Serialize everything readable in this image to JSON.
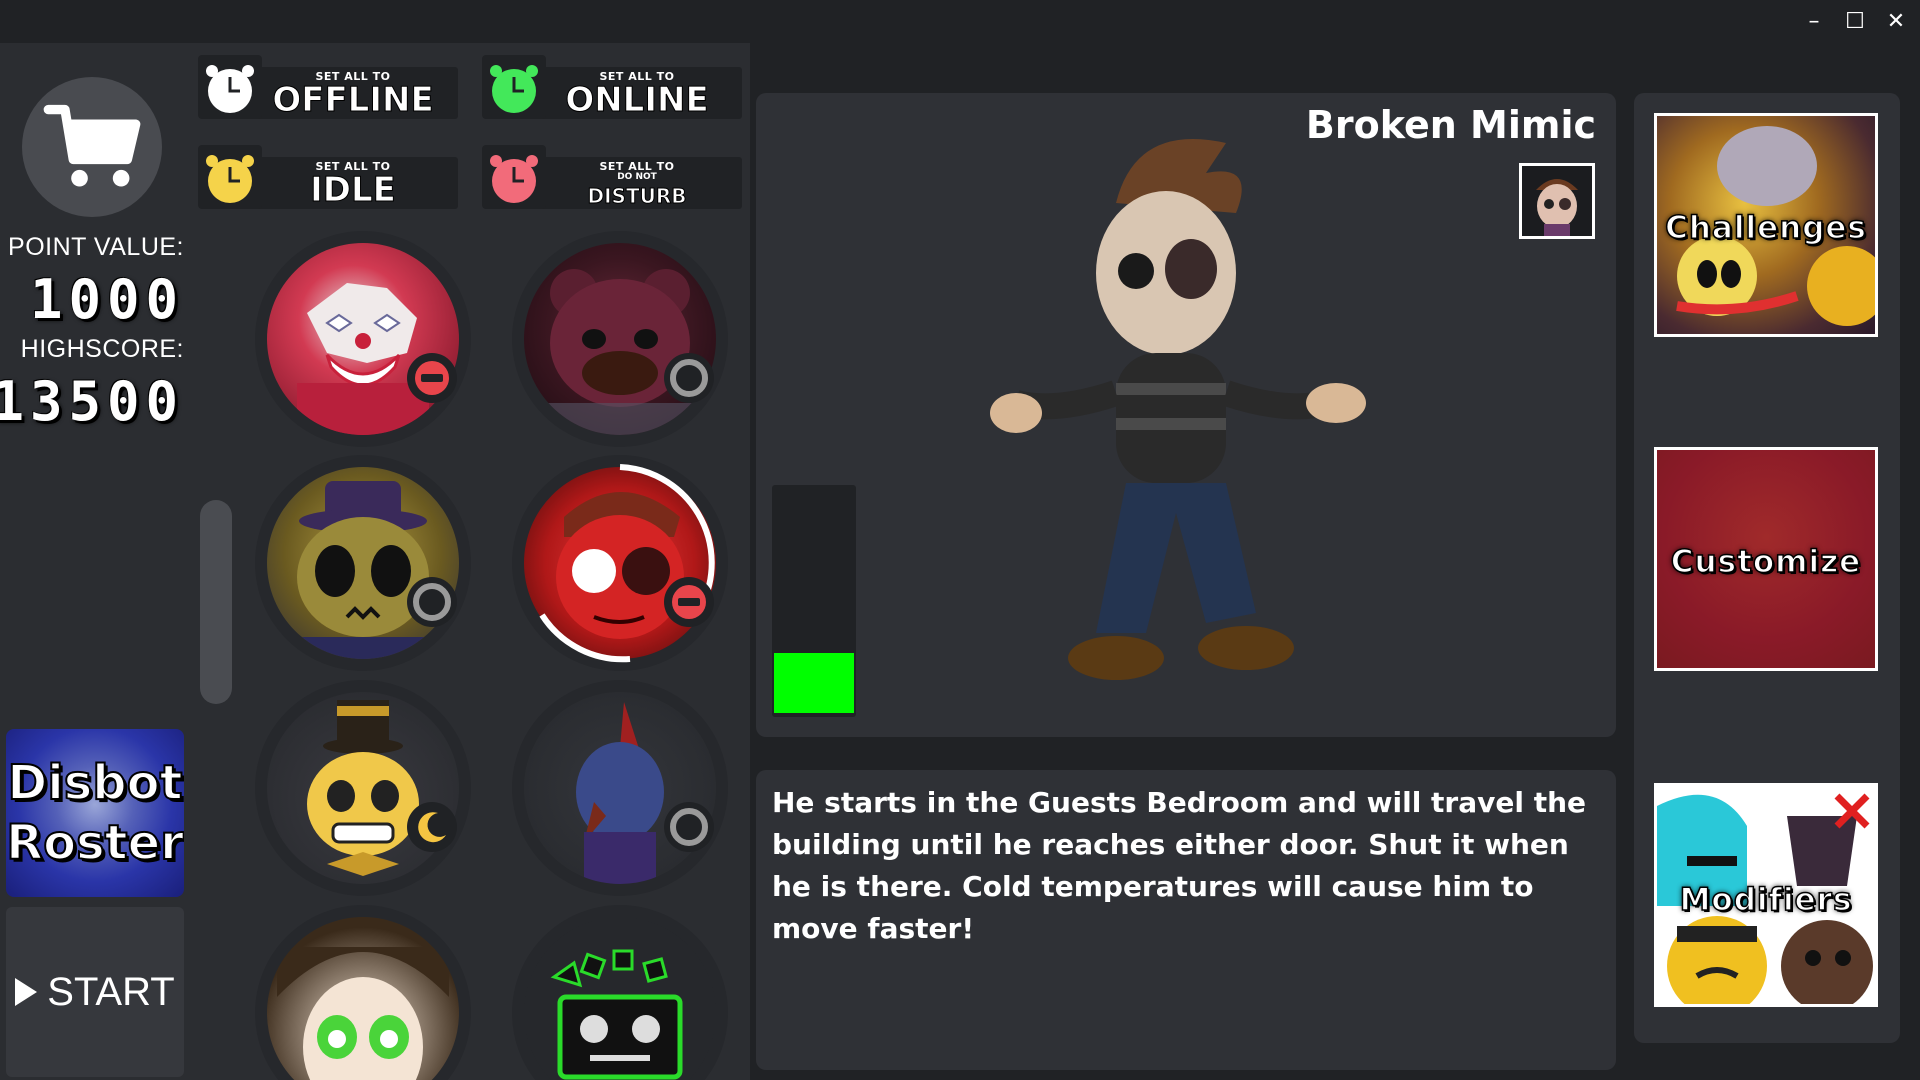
{
  "window": {
    "minimize_icon": "minimize-icon",
    "maximize_icon": "maximize-icon",
    "close_icon": "close-icon",
    "min_glyph": "–",
    "max_glyph": "☐",
    "close_glyph": "✕"
  },
  "sidebar": {
    "shop_icon": "shopping-cart-icon",
    "point_value_label": "POINT VALUE:",
    "point_value": "1000",
    "highscore_label": "HIGHSCORE:",
    "highscore": "13500",
    "roster_line1": "Disbot",
    "roster_line2": "Roster",
    "start_label": "START"
  },
  "status_buttons": [
    {
      "small": "SET ALL TO",
      "big": "OFFLINE",
      "clock_color": "#ffffff"
    },
    {
      "small": "SET ALL TO",
      "big": "ONLINE",
      "clock_color": "#43e85a"
    },
    {
      "small": "SET ALL TO",
      "big": "IDLE",
      "clock_color": "#f5d34a"
    },
    {
      "small": "SET ALL TO",
      "mid": "DO NOT",
      "big": "DISTURB",
      "clock_color": "#f26b7a"
    }
  ],
  "roster": [
    {
      "name": "red-clown-character",
      "status": "dnd"
    },
    {
      "name": "dark-bear-character",
      "status": "offline"
    },
    {
      "name": "hat-bear-character",
      "status": "offline"
    },
    {
      "name": "broken-mimic-character",
      "status": "dnd"
    },
    {
      "name": "tophat-skull-character",
      "status": "idle"
    },
    {
      "name": "blue-bird-character",
      "status": "offline"
    },
    {
      "name": "green-eyed-character",
      "status": "none"
    },
    {
      "name": "green-robot-character",
      "status": "none"
    }
  ],
  "preview": {
    "character_name": "Broken Mimic",
    "meter_level_percent": 27
  },
  "description": "He starts in the Guests Bedroom and will travel the building until he reaches either door. Shut it when he is there. Cold temperatures will cause him to move faster!",
  "side_menu": {
    "challenges": "Challenges",
    "customize": "Customize",
    "modifiers": "Modifiers"
  },
  "colors": {
    "dnd": "#e8454b",
    "idle": "#f5c542",
    "offline": "#9a9a9a",
    "meter": "#00ff00"
  }
}
